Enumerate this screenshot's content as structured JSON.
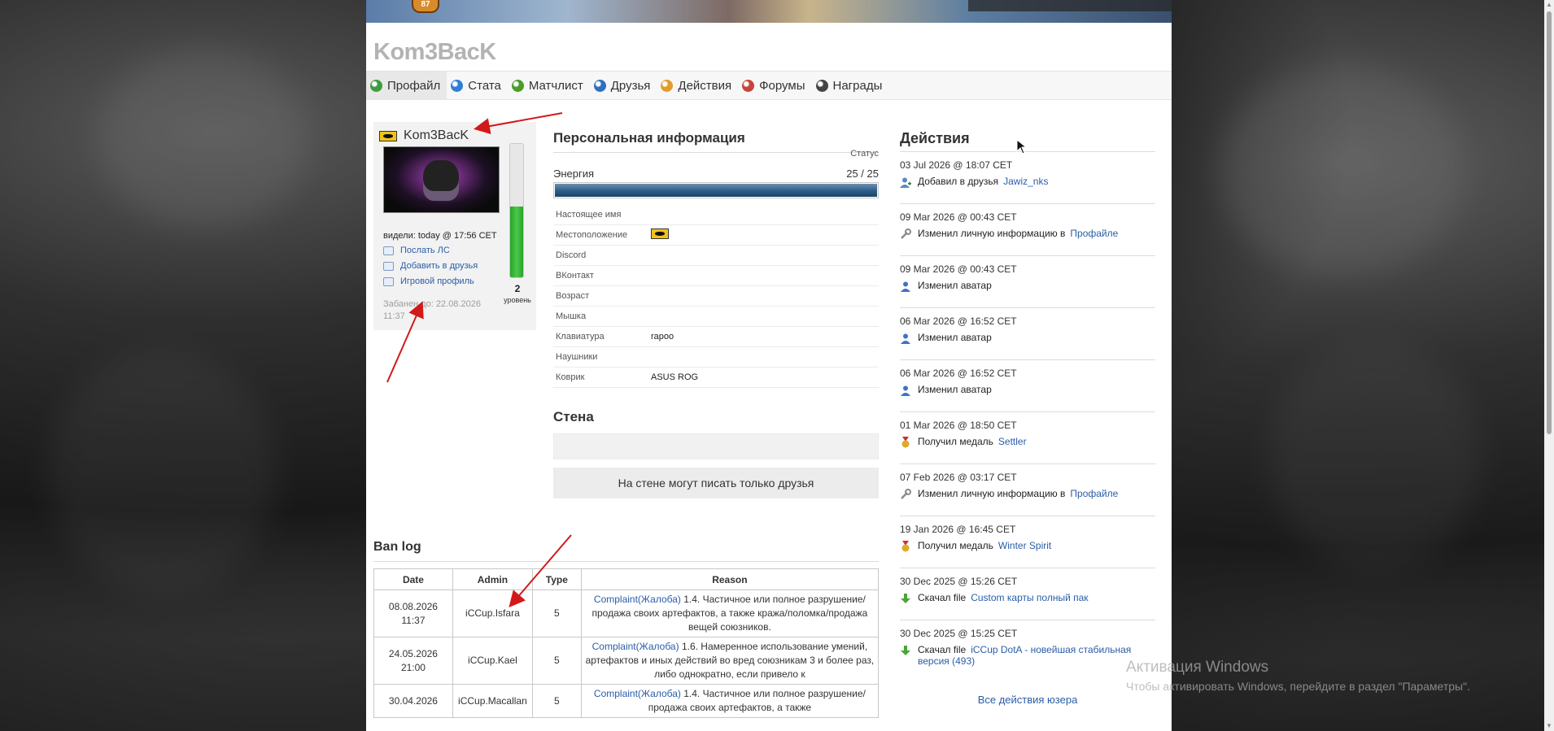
{
  "site": {
    "title": "Kom3BacK",
    "banner_emblem": "87"
  },
  "tabs": [
    {
      "label": "Профайл",
      "color": "#3e9b3e"
    },
    {
      "label": "Стата",
      "color": "#2e7fd6"
    },
    {
      "label": "Матчлист",
      "color": "#4a9d2a"
    },
    {
      "label": "Друзья",
      "color": "#2f6fc0"
    },
    {
      "label": "Действия",
      "color": "#e39b2b"
    },
    {
      "label": "Форумы",
      "color": "#c6443d"
    },
    {
      "label": "Награды",
      "color": "#444444"
    }
  ],
  "profile": {
    "username": "Kom3BacK",
    "seen": "видели: today @ 17:56 CET",
    "send_pm": "Послать ЛС",
    "add_friend": "Добавить в друзья",
    "game_profile": "Игровой профиль",
    "banned_until": "Забанен до: 22.08.2026 11:37",
    "level": "2",
    "level_label": "уровень",
    "level_progress": 0.53
  },
  "personal": {
    "title": "Персональная информация",
    "status_label": "Статус",
    "energy_label": "Энергия",
    "energy_value": "25 / 25",
    "energy_fraction": 1.0,
    "rows": [
      {
        "key": "Настоящее имя",
        "val": ""
      },
      {
        "key": "Местоположение",
        "val": ""
      },
      {
        "key": "Discord",
        "val": ""
      },
      {
        "key": "ВКонтакт",
        "val": ""
      },
      {
        "key": "Возраст",
        "val": ""
      },
      {
        "key": "Мышка",
        "val": ""
      },
      {
        "key": "Клавиатура",
        "val": "rapoo"
      },
      {
        "key": "Наушники",
        "val": ""
      },
      {
        "key": "Коврик",
        "val": "ASUS ROG"
      }
    ]
  },
  "wall": {
    "title": "Стена",
    "note": "На стене могут писать только друзья"
  },
  "banlog": {
    "title": "Ban log",
    "headers": [
      "Date",
      "Admin",
      "Type",
      "Reason"
    ],
    "rows": [
      {
        "date": "08.08.2026 11:37",
        "admin": "iCCup.Isfara",
        "type": "5",
        "link": "Complaint(Жалоба)",
        "reason": " 1.4. Частичное или полное разрушение/продажа своих артефактов, а также кража/поломка/продажа вещей союзников."
      },
      {
        "date": "24.05.2026 21:00",
        "admin": "iCCup.Kael",
        "type": "5",
        "link": "Complaint(Жалоба)",
        "reason": " 1.6. Намеренное использование умений, артефактов и иных действий во вред союзникам 3 и более раз, либо однократно, если привело к"
      },
      {
        "date": "30.04.2026",
        "admin": "iCCup.Macallan",
        "type": "5",
        "link": "Complaint(Жалоба)",
        "reason": " 1.4. Частичное или полное разрушение/продажа своих артефактов, а также"
      }
    ]
  },
  "actions": {
    "title": "Действия",
    "all_link": "Все действия юзера",
    "items": [
      {
        "date": "03 Jul 2026 @ 18:07 CET",
        "text": "Добавил в друзья",
        "link": "Jawiz_nks",
        "icon": "add-friend-icon",
        "color": "#5c86c7"
      },
      {
        "date": "09 Mar 2026 @ 00:43 CET",
        "text": "Изменил личную информацию в",
        "link": "Профайле",
        "icon": "wrench-icon",
        "color": "#8a8a8a"
      },
      {
        "date": "09 Mar 2026 @ 00:43 CET",
        "text": "Изменил аватар",
        "link": "",
        "icon": "user-icon",
        "color": "#3b73c6"
      },
      {
        "date": "06 Mar 2026 @ 16:52 CET",
        "text": "Изменил аватар",
        "link": "",
        "icon": "user-icon",
        "color": "#3b73c6"
      },
      {
        "date": "06 Mar 2026 @ 16:52 CET",
        "text": "Изменил аватар",
        "link": "",
        "icon": "user-icon",
        "color": "#3b73c6"
      },
      {
        "date": "01 Mar 2026 @ 18:50 CET",
        "text": "Получил медаль",
        "link": "Settler",
        "icon": "medal-icon",
        "color": "#e0a92a"
      },
      {
        "date": "07 Feb 2026 @ 03:17 CET",
        "text": "Изменил личную информацию в",
        "link": "Профайле",
        "icon": "wrench-icon",
        "color": "#8a8a8a"
      },
      {
        "date": "19 Jan 2026 @ 16:45 CET",
        "text": "Получил медаль",
        "link": "Winter Spirit",
        "icon": "medal-icon",
        "color": "#e0a92a"
      },
      {
        "date": "30 Dec 2025 @ 15:26 CET",
        "text": "Скачал  file",
        "link": "Custom карты полный пак",
        "icon": "download-icon",
        "color": "#4aa63a"
      },
      {
        "date": "30 Dec 2025 @ 15:25 CET",
        "text": "Скачал file",
        "link": "iCCup DotA - новейшая стабильная версия (493)",
        "icon": "download-icon",
        "color": "#4aa63a"
      }
    ]
  },
  "watermark": {
    "title": "Активация Windows",
    "sub": "Чтобы активировать Windows, перейдите в раздел \"Параметры\"."
  }
}
